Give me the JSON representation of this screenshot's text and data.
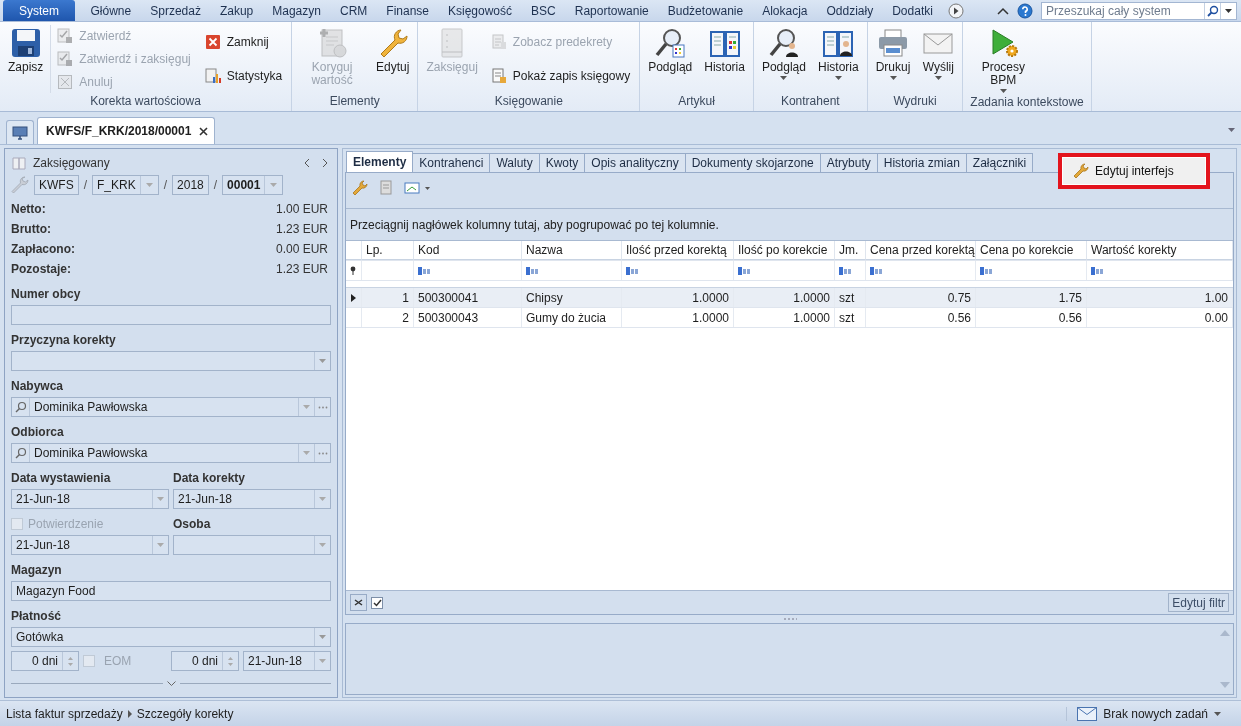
{
  "menu": {
    "tabs": [
      {
        "label": "System",
        "selected": true
      },
      {
        "label": "Główne",
        "selected": false
      },
      {
        "label": "Sprzedaż",
        "selected": false
      },
      {
        "label": "Zakup",
        "selected": false
      },
      {
        "label": "Magazyn",
        "selected": false
      },
      {
        "label": "CRM",
        "selected": false
      },
      {
        "label": "Finanse",
        "selected": false
      },
      {
        "label": "Księgowość",
        "selected": false
      },
      {
        "label": "BSC",
        "selected": false
      },
      {
        "label": "Raportowanie",
        "selected": false
      },
      {
        "label": "Budżetowanie",
        "selected": false
      },
      {
        "label": "Alokacja",
        "selected": false
      },
      {
        "label": "Oddziały",
        "selected": false
      },
      {
        "label": "Dodatki",
        "selected": false
      }
    ],
    "search": {
      "placeholder": "Przeszukaj cały system"
    }
  },
  "ribbon": {
    "groups": [
      {
        "title": "Korekta wartościowa",
        "items": [
          {
            "kind": "large",
            "buttons": [
              {
                "label": "Zapisz",
                "disabled": false,
                "dropdown": false
              }
            ]
          },
          {
            "kind": "stack",
            "buttons": [
              {
                "label": "Zatwierdź",
                "disabled": true
              },
              {
                "label": "Zatwierdź i zaksięguj",
                "disabled": true
              },
              {
                "label": "Anuluj",
                "disabled": true
              }
            ]
          },
          {
            "kind": "stack",
            "buttons": [
              {
                "label": "Zamknij",
                "disabled": false
              },
              {
                "label": "Statystyka",
                "disabled": false
              }
            ]
          }
        ]
      },
      {
        "title": "Elementy",
        "items": [
          {
            "kind": "large",
            "buttons": [
              {
                "label": "Koryguj wartość",
                "disabled": true,
                "dropdown": false
              },
              {
                "label": "Edytuj",
                "disabled": false,
                "dropdown": false
              }
            ]
          }
        ]
      },
      {
        "title": "Księgowanie",
        "items": [
          {
            "kind": "large",
            "buttons": [
              {
                "label": "Zaksięguj",
                "disabled": true,
                "dropdown": false
              }
            ]
          },
          {
            "kind": "stack",
            "buttons": [
              {
                "label": "Zobacz predekrety",
                "disabled": true
              },
              {
                "label": "Pokaż zapis księgowy",
                "disabled": false
              }
            ]
          }
        ]
      },
      {
        "title": "Artykuł",
        "items": [
          {
            "kind": "large",
            "buttons": [
              {
                "label": "Podgląd",
                "disabled": false,
                "dropdown": false
              },
              {
                "label": "Historia",
                "disabled": false,
                "dropdown": false
              }
            ]
          }
        ]
      },
      {
        "title": "Kontrahent",
        "items": [
          {
            "kind": "large",
            "buttons": [
              {
                "label": "Podgląd",
                "disabled": false,
                "dropdown": true
              },
              {
                "label": "Historia",
                "disabled": false,
                "dropdown": true
              }
            ]
          }
        ]
      },
      {
        "title": "Wydruki",
        "items": [
          {
            "kind": "large",
            "buttons": [
              {
                "label": "Drukuj",
                "disabled": false,
                "dropdown": true
              },
              {
                "label": "Wyślij",
                "disabled": false,
                "dropdown": true
              }
            ]
          }
        ]
      },
      {
        "title": "Zadania kontekstowe",
        "items": [
          {
            "kind": "large",
            "buttons": [
              {
                "label": "Procesy BPM",
                "disabled": false,
                "dropdown": true
              }
            ]
          }
        ]
      }
    ]
  },
  "document_tabs": [
    {
      "label": "KWFS/F_KRK/2018/00001",
      "selected": true
    }
  ],
  "header": {
    "status": "Zaksięgowany",
    "separator": "/",
    "number": [
      {
        "value": "KWFS",
        "dropdown": false,
        "bold": false
      },
      {
        "value": "F_KRK",
        "dropdown": true,
        "bold": false
      },
      {
        "value": "2018",
        "dropdown": false,
        "bold": false
      },
      {
        "value": "00001",
        "dropdown": true,
        "bold": true
      }
    ]
  },
  "totals": [
    {
      "label": "Netto:",
      "value": "1.00 EUR"
    },
    {
      "label": "Brutto:",
      "value": "1.23 EUR"
    },
    {
      "label": "Zapłacono:",
      "value": "0.00 EUR"
    },
    {
      "label": "Pozostaje:",
      "value": "1.23 EUR"
    }
  ],
  "fields": [
    {
      "kind": "text",
      "label": "Numer obcy"
    },
    {
      "kind": "combo",
      "label": "Przyczyna korekty"
    },
    {
      "kind": "lookup",
      "label": "Nabywca",
      "value": "Dominika Pawłowska"
    },
    {
      "kind": "lookup",
      "label": "Odbiorca",
      "value": "Dominika Pawłowska"
    },
    {
      "kind": "pair",
      "items": [
        {
          "label": "Data wystawienia",
          "value": "21-Jun-18"
        },
        {
          "label": "Data korekty",
          "value": "21-Jun-18"
        }
      ]
    },
    {
      "kind": "pair",
      "items": [
        {
          "label": "Potwierdzenie",
          "checkbox": true,
          "checked": false,
          "disabled": true,
          "value": "21-Jun-18"
        },
        {
          "label": "Osoba"
        }
      ]
    },
    {
      "kind": "text",
      "label": "Magazyn",
      "value": "Magazyn Food"
    },
    {
      "kind": "combo",
      "label": "Płatność",
      "value": "Gotówka"
    }
  ],
  "payment_terms": {
    "days": "0 dni",
    "eom": {
      "label": "EOM",
      "checked": false,
      "disabled": true
    },
    "days_2": "0 dni",
    "date": "21-Jun-18"
  },
  "detail_tabs": [
    {
      "label": "Elementy",
      "selected": true
    },
    {
      "label": "Kontrahenci",
      "selected": false
    },
    {
      "label": "Waluty",
      "selected": false
    },
    {
      "label": "Kwoty",
      "selected": false
    },
    {
      "label": "Opis analityczny",
      "selected": false
    },
    {
      "label": "Dokumenty skojarzone",
      "selected": false
    },
    {
      "label": "Atrybuty",
      "selected": false
    },
    {
      "label": "Historia zmian",
      "selected": false
    },
    {
      "label": "Załączniki",
      "selected": false
    }
  ],
  "edit_interface": {
    "label": "Edytuj interfejs"
  },
  "group_panel": "Przeciągnij nagłówek kolumny tutaj, aby pogrupować po tej kolumnie.",
  "table": {
    "columns": [
      "Lp.",
      "Kod",
      "Nazwa",
      "Ilość przed korektą",
      "Ilość po korekcie",
      "Jm.",
      "Cena przed korektą",
      "Cena po korekcie",
      "Wartość korekty"
    ],
    "rows": [
      {
        "current": true,
        "cells": [
          "1",
          "500300041",
          "Chipsy",
          "1.0000",
          "1.0000",
          "szt",
          "0.75",
          "1.75",
          "1.00"
        ]
      },
      {
        "current": false,
        "cells": [
          "2",
          "500300043",
          "Gumy do żucia",
          "1.0000",
          "1.0000",
          "szt",
          "0.56",
          "0.56",
          "0.00"
        ]
      }
    ]
  },
  "filter_bar": {
    "enabled": true,
    "button": "Edytuj filtr"
  },
  "status_bar": {
    "breadcrumbs": [
      "Lista faktur sprzedaży",
      "Szczegóły korekty"
    ],
    "tasks": "Brak nowych zadań"
  }
}
